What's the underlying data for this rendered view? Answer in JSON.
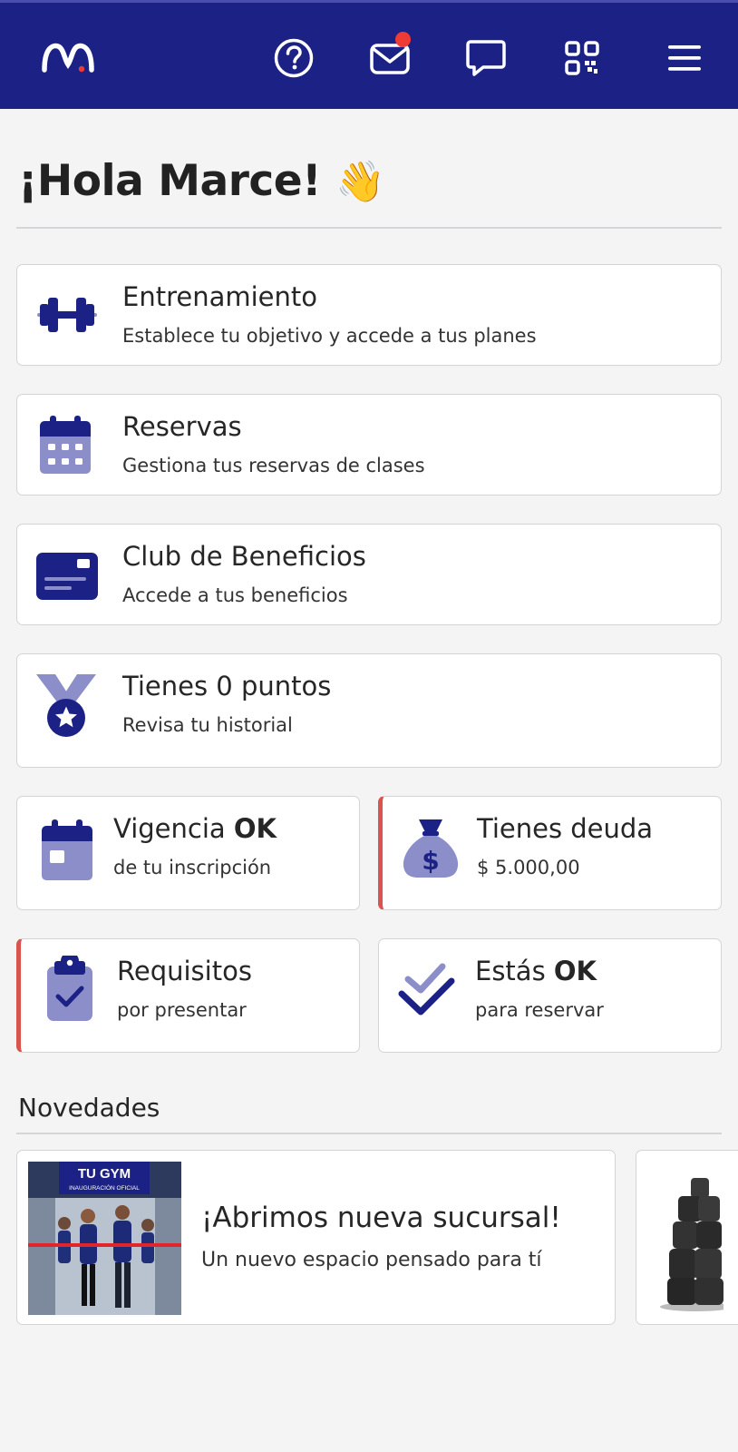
{
  "header": {
    "icons": [
      "logo",
      "help-icon",
      "mail-icon",
      "chat-icon",
      "qr-code-icon",
      "menu-icon"
    ],
    "colors": {
      "bar": "#1c2285",
      "notification": "#ee3b35"
    }
  },
  "greeting": {
    "text": "¡Hola Marce!",
    "emoji": "👋"
  },
  "cards": {
    "training": {
      "title": "Entrenamiento",
      "subtitle": "Establece tu objetivo y accede a tus planes"
    },
    "reservations": {
      "title": "Reservas",
      "subtitle": "Gestiona tus reservas de clases"
    },
    "benefits": {
      "title": "Club de Beneficios",
      "subtitle": "Accede a tus beneficios"
    },
    "points": {
      "title": "Tienes 0 puntos",
      "subtitle": "Revisa tu historial"
    },
    "validity": {
      "title_prefix": "Vigencia",
      "title_bold": "OK",
      "subtitle": "de tu inscripción"
    },
    "debt": {
      "title": "Tienes deuda",
      "subtitle": "$ 5.000,00"
    },
    "requirements": {
      "title": "Requisitos",
      "subtitle": "por presentar"
    },
    "booking_status": {
      "title_prefix": "Estás",
      "title_bold": "OK",
      "subtitle": "para reservar"
    }
  },
  "news": {
    "section_title": "Novedades",
    "items": [
      {
        "title": "¡Abrimos nueva sucursal!",
        "subtitle": "Un nuevo espacio pensado para tí",
        "image_banner": "TU GYM",
        "image_caption": "INAUGURACIÓN OFICIAL"
      }
    ]
  },
  "colors": {
    "accent": "#1c2285",
    "icon_light": "#8c8ec9",
    "alert": "#d9534f"
  }
}
